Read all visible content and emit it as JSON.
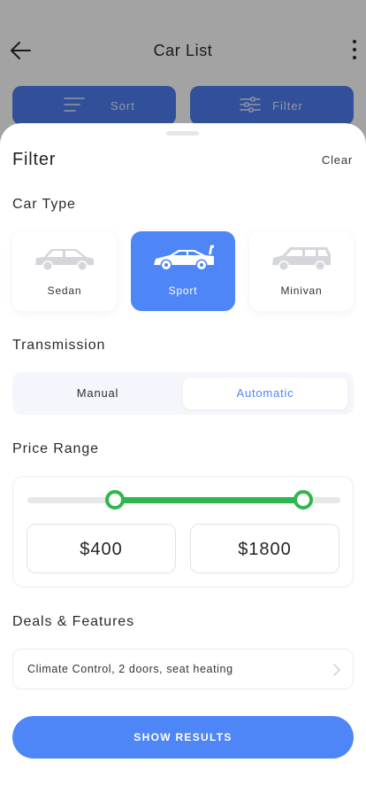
{
  "header": {
    "title": "Car List",
    "back_icon": "arrow-left-icon",
    "more_icon": "more-vertical-icon"
  },
  "toolbar": {
    "sort_label": "Sort",
    "filter_label": "Filter"
  },
  "filter": {
    "title": "Filter",
    "clear_label": "Clear",
    "car_type": {
      "title": "Car Type",
      "options": [
        {
          "label": "Sedan",
          "icon": "sedan-car-icon",
          "selected": false
        },
        {
          "label": "Sport",
          "icon": "sport-car-icon",
          "selected": true
        },
        {
          "label": "Minivan",
          "icon": "minivan-icon",
          "selected": false
        }
      ]
    },
    "transmission": {
      "title": "Transmission",
      "options": [
        {
          "label": "Manual",
          "selected": false
        },
        {
          "label": "Automatic",
          "selected": true
        }
      ]
    },
    "price": {
      "title": "Price Range",
      "min_label": "$400",
      "max_label": "$1800",
      "min_fraction": 0.28,
      "max_fraction": 0.88
    },
    "deals": {
      "title": "Deals & Features",
      "value": "Climate Control, 2 doors, seat heating"
    },
    "show_results_label": "SHOW RESULTS"
  },
  "colors": {
    "accent": "#4f86f7",
    "range": "#2fb74e",
    "background_button": "#4f7ef0"
  }
}
